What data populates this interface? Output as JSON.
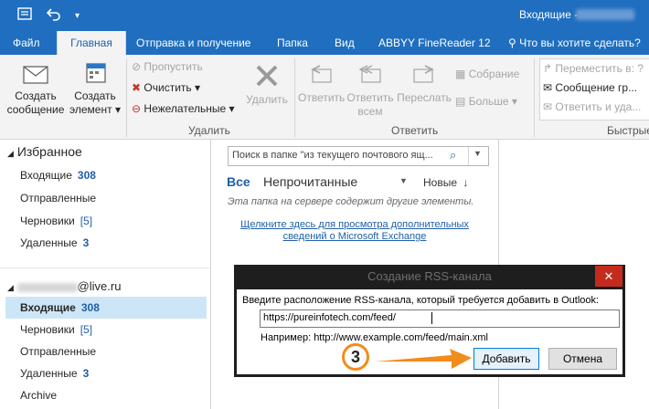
{
  "titlebar": {
    "title": "Входящие - "
  },
  "tabs": [
    {
      "label": "Файл"
    },
    {
      "label": "Главная"
    },
    {
      "label": "Отправка и получение"
    },
    {
      "label": "Папка"
    },
    {
      "label": "Вид"
    },
    {
      "label": "ABBYY FineReader 12"
    },
    {
      "label": "Что вы хотите сделать?"
    }
  ],
  "ribbon": {
    "new_message": [
      "Создать",
      "сообщение"
    ],
    "new_item": [
      "Создать",
      "элемент"
    ],
    "ignore": "Пропустить",
    "clean_up": "Очистить",
    "junk": "Нежелательные",
    "delete": "Удалить",
    "reply": "Ответить",
    "reply_all": [
      "Ответить",
      "всем"
    ],
    "forward": "Переслать",
    "meeting": "Собрание",
    "more": "Больше",
    "move_to": "Переместить в: ?",
    "to_manager": "Сообщение гр...",
    "reply_delete": "Ответить и уда...",
    "group_delete": "Удалить",
    "group_respond": "Ответить",
    "group_quick": "Быстрые"
  },
  "favorites": {
    "header": "Избранное",
    "items": [
      {
        "name": "Входящие",
        "count": "308"
      },
      {
        "name": "Отправленные",
        "count": ""
      },
      {
        "name": "Черновики",
        "count": "[5]"
      },
      {
        "name": "Удаленные",
        "count": "3"
      }
    ]
  },
  "account": {
    "email_suffix": "@live.ru",
    "items": [
      {
        "name": "Входящие",
        "count": "308"
      },
      {
        "name": "Черновики",
        "count": "[5]"
      },
      {
        "name": "Отправленные",
        "count": ""
      },
      {
        "name": "Удаленные",
        "count": "3"
      },
      {
        "name": "Archive",
        "count": ""
      }
    ]
  },
  "messages": {
    "search_placeholder": "Поиск в папке \"из текущего почтового ящ...",
    "filter_all": "Все",
    "filter_unread": "Непрочитанные",
    "sort": "Новые",
    "notice": "Эта папка на сервере содержит другие элементы.",
    "link_line1": "Щелкните здесь для просмотра дополнительных",
    "link_line2": "сведений о Microsoft Exchange"
  },
  "dialog": {
    "title": "Создание RSS-канала",
    "prompt": "Введите расположение RSS-канала, который требуется добавить в Outlook:",
    "url_value": "https://pureinfotech.com/feed/",
    "example": "Например: http://www.example.com/feed/main.xml",
    "add_button": "Добавить",
    "cancel_button": "Отмена",
    "step_badge": "3"
  },
  "colors": {
    "brand": "#1f6ebf",
    "accent_arrow": "#f28c1c",
    "close_red": "#c42b1c",
    "link": "#1f5fa8"
  }
}
